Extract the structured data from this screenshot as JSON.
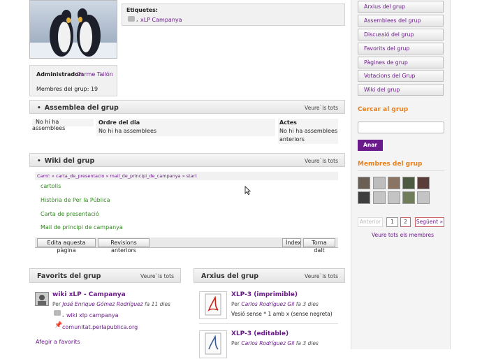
{
  "profile": {
    "tags_label": "Etiquetes:",
    "tag": "xLP Campanya",
    "admin_label": "Administrador:",
    "admin_name": "Carme Tailón",
    "members_label": "Membres del grup: 19"
  },
  "assemblea": {
    "title": "Assemblea del grup",
    "view_all": "Veure`ls tots",
    "no_assemblies": "No hi ha assemblees",
    "col_order": "Ordre del dia",
    "col_order_value": "No hi ha assemblees",
    "col_acts": "Actes",
    "col_acts_value_1": "No hi ha assemblees",
    "col_acts_value_2": "anteriors"
  },
  "wiki": {
    "title": "Wiki del grup",
    "view_all": "Veure`ls tots",
    "breadcrumb": "Camí: » carta_de_presentacio » mail_de_principi_de_campanya » start",
    "pages": [
      "cartolls",
      "Història de Per la Pública",
      "Carta de presentació",
      "Mail de principi de campanya"
    ],
    "btn_edit": "Edita aquesta pàgina",
    "btn_revisions": "Revisions anteriors",
    "btn_index": "Índex",
    "btn_back": "Torna dalt"
  },
  "favorits": {
    "title": "Favorits del grup",
    "view_all": "Veure`ls tots",
    "item_title": "wiki xLP - Campanya",
    "item_by": "Per",
    "item_author": "José Enrique Gómez Rodríguez",
    "item_time": "fa 11 dies",
    "item_tag": "wiki xlp campanya",
    "item_link": "comunitat.perlapublica.org",
    "add_link": "Afegir a favorits"
  },
  "arxius": {
    "title": "Arxius del grup",
    "view_all": "Veure`ls tots",
    "files": [
      {
        "title": "XLP-3 (imprimible)",
        "by": "Per",
        "author": "Carlos Rodríguez Gil",
        "time": "fa 3 dies",
        "desc": "Vesió sense * 1 amb x (sense negreta)"
      },
      {
        "title": "XLP-3 (editable)",
        "by": "Per",
        "author": "Carlos Rodríguez Gil",
        "time": "fa 3 dies",
        "desc": ""
      }
    ]
  },
  "sidebar": {
    "nav": [
      "Arxius del grup",
      "Assemblees del grup",
      "Discussió del grup",
      "Favorits del grup",
      "Pàgines de grup",
      "Votacions del Grup",
      "Wiki del grup"
    ],
    "search_title": "Cercar al grup",
    "search_button": "Anar",
    "members_title": "Membres del grup",
    "pager_prev": "Anterior",
    "pager_page1": "1",
    "pager_page2": "2",
    "pager_next": "Següent »",
    "view_all_members": "Veure tots els membres"
  }
}
